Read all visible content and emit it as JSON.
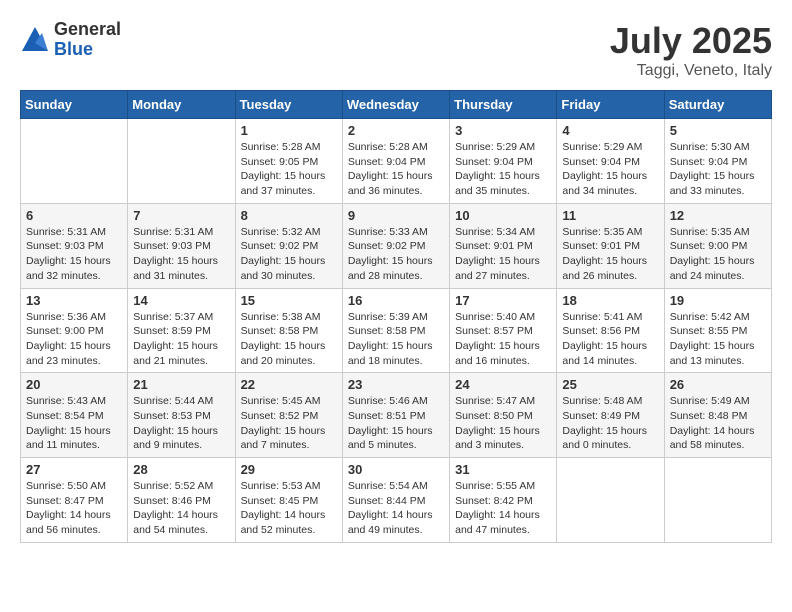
{
  "logo": {
    "general": "General",
    "blue": "Blue"
  },
  "header": {
    "month": "July 2025",
    "location": "Taggi, Veneto, Italy"
  },
  "weekdays": [
    "Sunday",
    "Monday",
    "Tuesday",
    "Wednesday",
    "Thursday",
    "Friday",
    "Saturday"
  ],
  "weeks": [
    [
      {
        "day": "",
        "info": ""
      },
      {
        "day": "",
        "info": ""
      },
      {
        "day": "1",
        "info": "Sunrise: 5:28 AM\nSunset: 9:05 PM\nDaylight: 15 hours\nand 37 minutes."
      },
      {
        "day": "2",
        "info": "Sunrise: 5:28 AM\nSunset: 9:04 PM\nDaylight: 15 hours\nand 36 minutes."
      },
      {
        "day": "3",
        "info": "Sunrise: 5:29 AM\nSunset: 9:04 PM\nDaylight: 15 hours\nand 35 minutes."
      },
      {
        "day": "4",
        "info": "Sunrise: 5:29 AM\nSunset: 9:04 PM\nDaylight: 15 hours\nand 34 minutes."
      },
      {
        "day": "5",
        "info": "Sunrise: 5:30 AM\nSunset: 9:04 PM\nDaylight: 15 hours\nand 33 minutes."
      }
    ],
    [
      {
        "day": "6",
        "info": "Sunrise: 5:31 AM\nSunset: 9:03 PM\nDaylight: 15 hours\nand 32 minutes."
      },
      {
        "day": "7",
        "info": "Sunrise: 5:31 AM\nSunset: 9:03 PM\nDaylight: 15 hours\nand 31 minutes."
      },
      {
        "day": "8",
        "info": "Sunrise: 5:32 AM\nSunset: 9:02 PM\nDaylight: 15 hours\nand 30 minutes."
      },
      {
        "day": "9",
        "info": "Sunrise: 5:33 AM\nSunset: 9:02 PM\nDaylight: 15 hours\nand 28 minutes."
      },
      {
        "day": "10",
        "info": "Sunrise: 5:34 AM\nSunset: 9:01 PM\nDaylight: 15 hours\nand 27 minutes."
      },
      {
        "day": "11",
        "info": "Sunrise: 5:35 AM\nSunset: 9:01 PM\nDaylight: 15 hours\nand 26 minutes."
      },
      {
        "day": "12",
        "info": "Sunrise: 5:35 AM\nSunset: 9:00 PM\nDaylight: 15 hours\nand 24 minutes."
      }
    ],
    [
      {
        "day": "13",
        "info": "Sunrise: 5:36 AM\nSunset: 9:00 PM\nDaylight: 15 hours\nand 23 minutes."
      },
      {
        "day": "14",
        "info": "Sunrise: 5:37 AM\nSunset: 8:59 PM\nDaylight: 15 hours\nand 21 minutes."
      },
      {
        "day": "15",
        "info": "Sunrise: 5:38 AM\nSunset: 8:58 PM\nDaylight: 15 hours\nand 20 minutes."
      },
      {
        "day": "16",
        "info": "Sunrise: 5:39 AM\nSunset: 8:58 PM\nDaylight: 15 hours\nand 18 minutes."
      },
      {
        "day": "17",
        "info": "Sunrise: 5:40 AM\nSunset: 8:57 PM\nDaylight: 15 hours\nand 16 minutes."
      },
      {
        "day": "18",
        "info": "Sunrise: 5:41 AM\nSunset: 8:56 PM\nDaylight: 15 hours\nand 14 minutes."
      },
      {
        "day": "19",
        "info": "Sunrise: 5:42 AM\nSunset: 8:55 PM\nDaylight: 15 hours\nand 13 minutes."
      }
    ],
    [
      {
        "day": "20",
        "info": "Sunrise: 5:43 AM\nSunset: 8:54 PM\nDaylight: 15 hours\nand 11 minutes."
      },
      {
        "day": "21",
        "info": "Sunrise: 5:44 AM\nSunset: 8:53 PM\nDaylight: 15 hours\nand 9 minutes."
      },
      {
        "day": "22",
        "info": "Sunrise: 5:45 AM\nSunset: 8:52 PM\nDaylight: 15 hours\nand 7 minutes."
      },
      {
        "day": "23",
        "info": "Sunrise: 5:46 AM\nSunset: 8:51 PM\nDaylight: 15 hours\nand 5 minutes."
      },
      {
        "day": "24",
        "info": "Sunrise: 5:47 AM\nSunset: 8:50 PM\nDaylight: 15 hours\nand 3 minutes."
      },
      {
        "day": "25",
        "info": "Sunrise: 5:48 AM\nSunset: 8:49 PM\nDaylight: 15 hours\nand 0 minutes."
      },
      {
        "day": "26",
        "info": "Sunrise: 5:49 AM\nSunset: 8:48 PM\nDaylight: 14 hours\nand 58 minutes."
      }
    ],
    [
      {
        "day": "27",
        "info": "Sunrise: 5:50 AM\nSunset: 8:47 PM\nDaylight: 14 hours\nand 56 minutes."
      },
      {
        "day": "28",
        "info": "Sunrise: 5:52 AM\nSunset: 8:46 PM\nDaylight: 14 hours\nand 54 minutes."
      },
      {
        "day": "29",
        "info": "Sunrise: 5:53 AM\nSunset: 8:45 PM\nDaylight: 14 hours\nand 52 minutes."
      },
      {
        "day": "30",
        "info": "Sunrise: 5:54 AM\nSunset: 8:44 PM\nDaylight: 14 hours\nand 49 minutes."
      },
      {
        "day": "31",
        "info": "Sunrise: 5:55 AM\nSunset: 8:42 PM\nDaylight: 14 hours\nand 47 minutes."
      },
      {
        "day": "",
        "info": ""
      },
      {
        "day": "",
        "info": ""
      }
    ]
  ]
}
